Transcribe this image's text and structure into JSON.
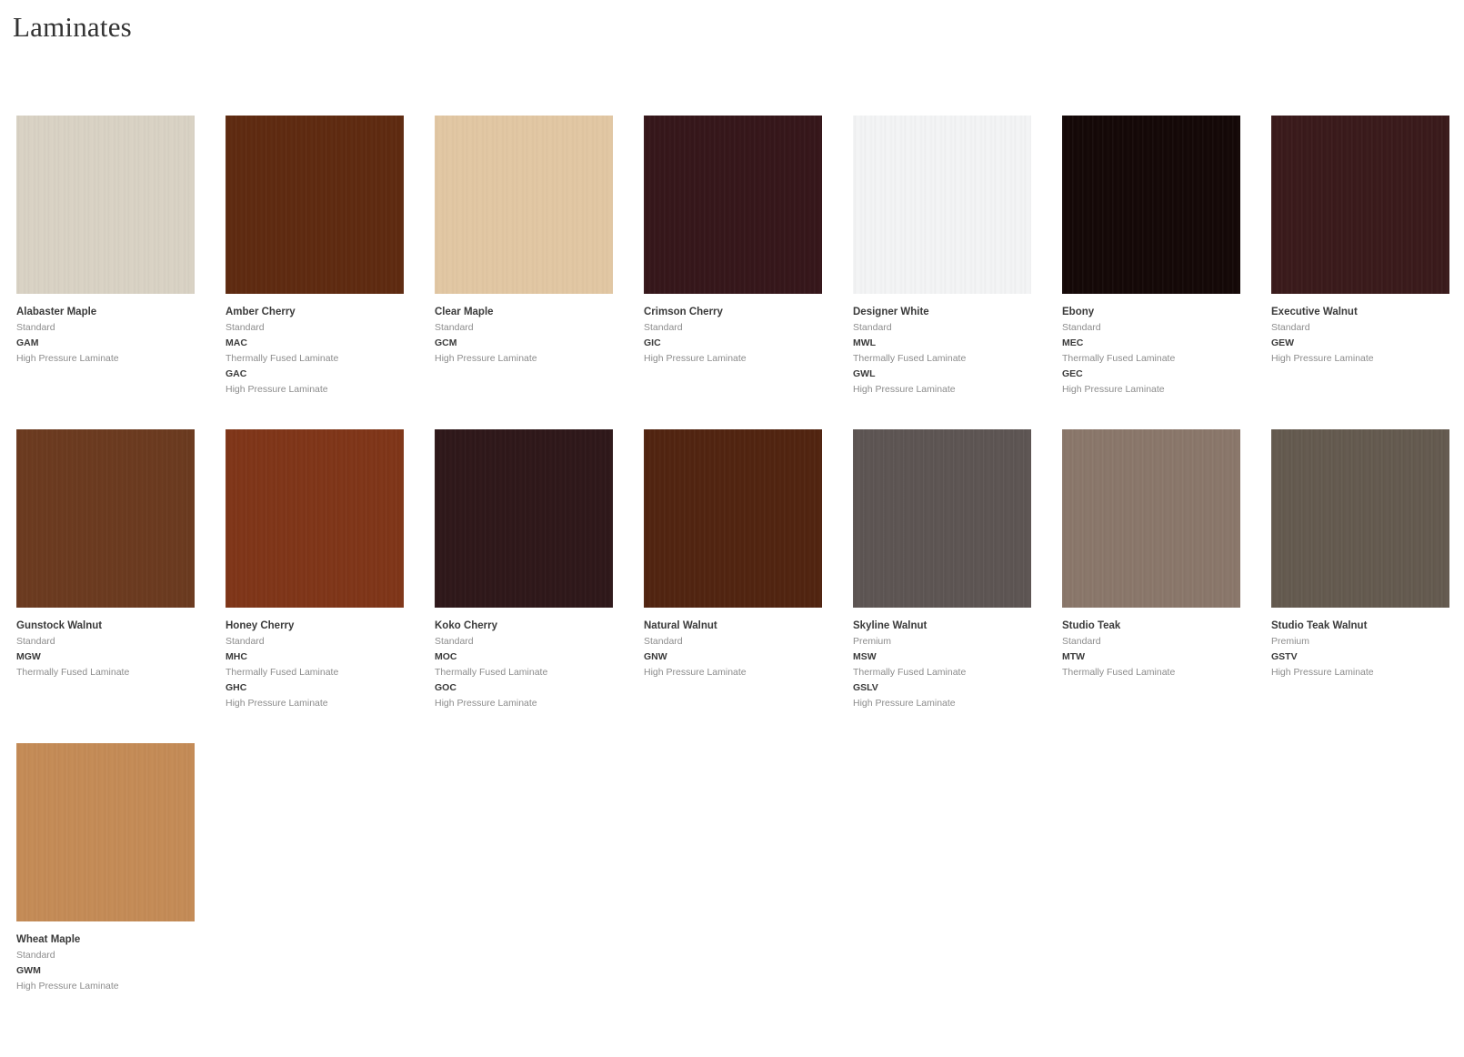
{
  "page": {
    "title": "Laminates"
  },
  "swatches": [
    {
      "name": "Alabaster Maple",
      "grade": "Standard",
      "color": "#d9d2c4",
      "codes": [
        {
          "code": "GAM",
          "type": "High Pressure Laminate"
        }
      ]
    },
    {
      "name": "Amber Cherry",
      "grade": "Standard",
      "color": "#5e2a10",
      "codes": [
        {
          "code": "MAC",
          "type": "Thermally Fused Laminate"
        },
        {
          "code": "GAC",
          "type": "High Pressure Laminate"
        }
      ]
    },
    {
      "name": "Clear Maple",
      "grade": "Standard",
      "color": "#e2c7a3",
      "codes": [
        {
          "code": "GCM",
          "type": "High Pressure Laminate"
        }
      ]
    },
    {
      "name": "Crimson Cherry",
      "grade": "Standard",
      "color": "#35161a",
      "codes": [
        {
          "code": "GIC",
          "type": "High Pressure Laminate"
        }
      ]
    },
    {
      "name": "Designer White",
      "grade": "Standard",
      "color": "#f3f4f5",
      "codes": [
        {
          "code": "MWL",
          "type": "Thermally Fused Laminate"
        },
        {
          "code": "GWL",
          "type": "High Pressure Laminate"
        }
      ]
    },
    {
      "name": "Ebony",
      "grade": "Standard",
      "color": "#140807",
      "codes": [
        {
          "code": "MEC",
          "type": "Thermally Fused Laminate"
        },
        {
          "code": "GEC",
          "type": "High Pressure Laminate"
        }
      ]
    },
    {
      "name": "Executive Walnut",
      "grade": "Standard",
      "color": "#3a1a1b",
      "codes": [
        {
          "code": "GEW",
          "type": "High Pressure Laminate"
        }
      ]
    },
    {
      "name": "Gunstock Walnut",
      "grade": "Standard",
      "color": "#6b3a1f",
      "codes": [
        {
          "code": "MGW",
          "type": "Thermally Fused Laminate"
        }
      ]
    },
    {
      "name": "Honey Cherry",
      "grade": "Standard",
      "color": "#7f3518",
      "codes": [
        {
          "code": "MHC",
          "type": "Thermally Fused Laminate"
        },
        {
          "code": "GHC",
          "type": "High Pressure Laminate"
        }
      ]
    },
    {
      "name": "Koko Cherry",
      "grade": "Standard",
      "color": "#2e1719",
      "codes": [
        {
          "code": "MOC",
          "type": "Thermally Fused Laminate"
        },
        {
          "code": "GOC",
          "type": "High Pressure Laminate"
        }
      ]
    },
    {
      "name": "Natural Walnut",
      "grade": "Standard",
      "color": "#512410",
      "codes": [
        {
          "code": "GNW",
          "type": "High Pressure Laminate"
        }
      ]
    },
    {
      "name": "Skyline Walnut",
      "grade": "Premium",
      "color": "#5d5553",
      "codes": [
        {
          "code": "MSW",
          "type": "Thermally Fused Laminate"
        },
        {
          "code": "GSLV",
          "type": "High Pressure Laminate"
        }
      ]
    },
    {
      "name": "Studio Teak",
      "grade": "Standard",
      "color": "#8a776a",
      "codes": [
        {
          "code": "MTW",
          "type": "Thermally Fused Laminate"
        }
      ]
    },
    {
      "name": "Studio Teak Walnut",
      "grade": "Premium",
      "color": "#645a4f",
      "codes": [
        {
          "code": "GSTV",
          "type": "High Pressure Laminate"
        }
      ]
    },
    {
      "name": "Wheat Maple",
      "grade": "Standard",
      "color": "#c48b56",
      "codes": [
        {
          "code": "GWM",
          "type": "High Pressure Laminate"
        }
      ]
    }
  ]
}
